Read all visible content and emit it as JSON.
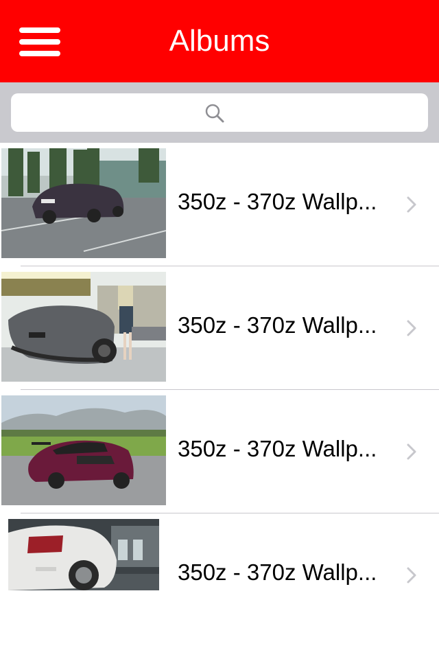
{
  "navbar": {
    "title": "Albums",
    "background": "#ff0000",
    "menu_icon": "hamburger-menu-icon"
  },
  "search": {
    "placeholder": "",
    "value": "",
    "icon": "search-icon"
  },
  "albums": [
    {
      "label": "350z - 370z Wallp...",
      "thumbnail": "dark-nissan-350z-parking-lot",
      "chevron": "chevron-right-icon"
    },
    {
      "label": "350z - 370z Wallp...",
      "thumbnail": "grey-nissan-370z-with-model",
      "chevron": "chevron-right-icon"
    },
    {
      "label": "350z - 370z Wallp...",
      "thumbnail": "purple-nissan-350z-mountains",
      "chevron": "chevron-right-icon"
    },
    {
      "label": "350z - 370z Wallp...",
      "thumbnail": "white-nissan-370z-garage",
      "chevron": "chevron-right-icon"
    }
  ]
}
